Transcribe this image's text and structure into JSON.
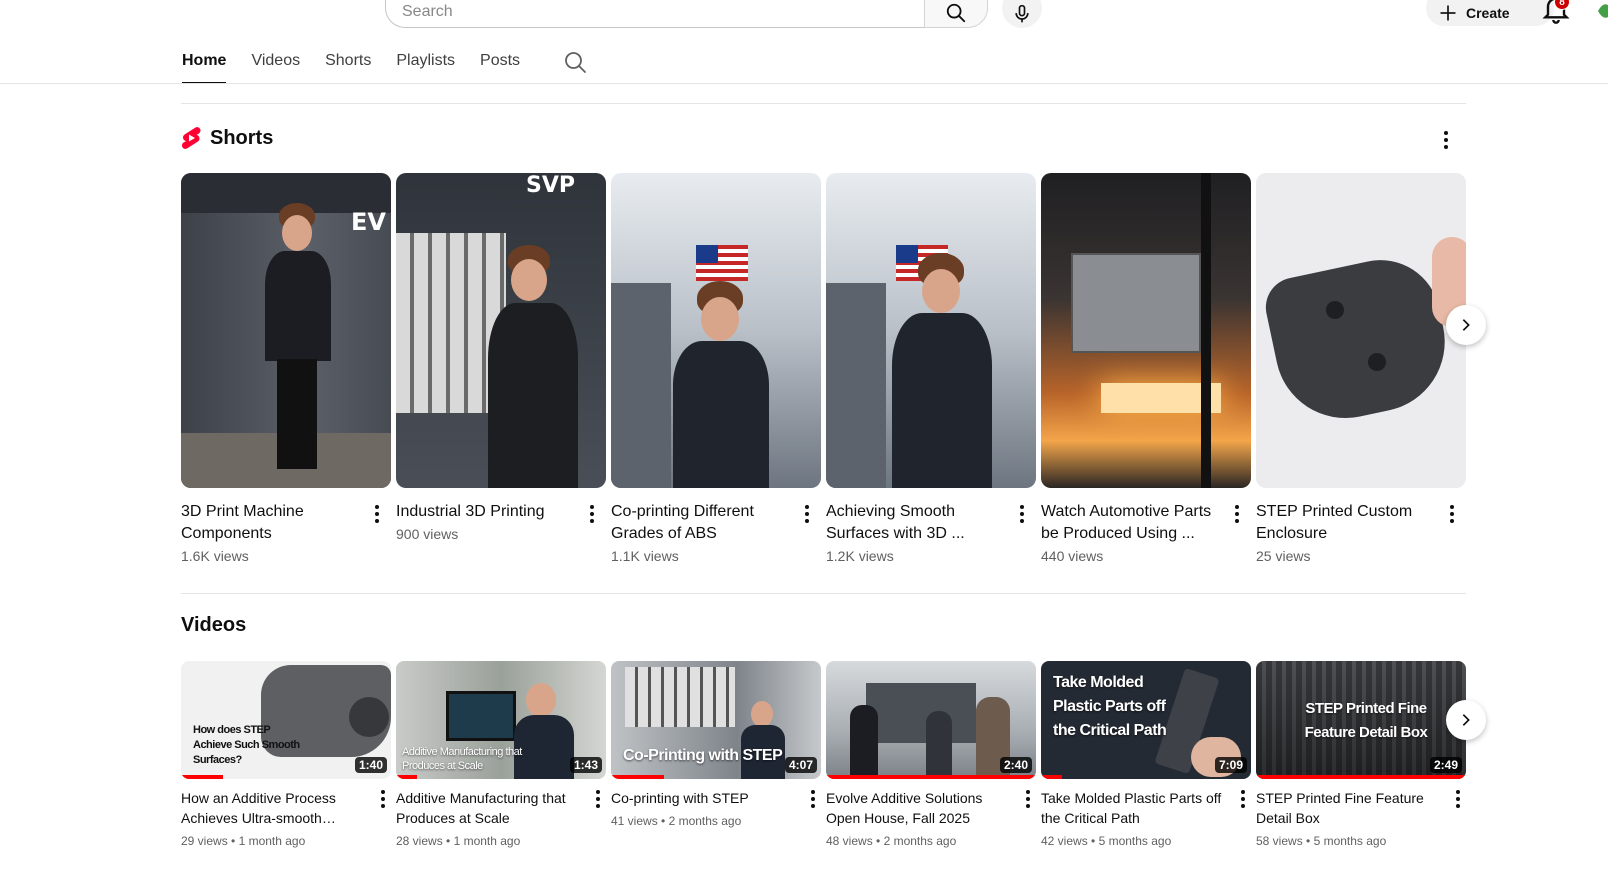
{
  "masthead": {
    "search_placeholder": "Search",
    "create_label": "Create",
    "notification_count": "8"
  },
  "tabs": [
    {
      "label": "Home",
      "active": true
    },
    {
      "label": "Videos",
      "active": false
    },
    {
      "label": "Shorts",
      "active": false
    },
    {
      "label": "Playlists",
      "active": false
    },
    {
      "label": "Posts",
      "active": false
    }
  ],
  "shorts_section": {
    "title": "Shorts",
    "items": [
      {
        "title": "3D Print Machine Components",
        "views": "1.6K views"
      },
      {
        "title": "Industrial 3D Printing",
        "views": "900 views"
      },
      {
        "title": "Co-printing Different Grades of ABS",
        "views": "1.1K views"
      },
      {
        "title": "Achieving Smooth Surfaces with 3D ...",
        "views": "1.2K views"
      },
      {
        "title": "Watch Automotive Parts be Produced Using ...",
        "views": "440 views"
      },
      {
        "title": "STEP Printed Custom Enclosure",
        "views": "25 views"
      }
    ]
  },
  "videos_section": {
    "title": "Videos",
    "items": [
      {
        "title": "How an Additive Process Achieves Ultra-smooth…",
        "views": "29 views",
        "age": "1 month ago",
        "duration": "1:40",
        "thumb_text": "How does STEP Achieve Such Smooth Surfaces?",
        "watched": 0.2
      },
      {
        "title": "Additive Manufacturing that Produces at Scale",
        "views": "28 views",
        "age": "1 month ago",
        "duration": "1:43",
        "thumb_text": "Additive Manufacturing that Produces at Scale",
        "watched": 0.1
      },
      {
        "title": "Co-printing with STEP",
        "views": "41 views",
        "age": "2 months ago",
        "duration": "4:07",
        "thumb_text": "Co-Printing with STEP",
        "watched": 0.25
      },
      {
        "title": "Evolve Additive Solutions Open House, Fall 2025",
        "views": "48 views",
        "age": "2 months ago",
        "duration": "2:40",
        "thumb_text": "",
        "watched": 1.0
      },
      {
        "title": "Take Molded Plastic Parts off the Critical Path",
        "views": "42 views",
        "age": "5 months ago",
        "duration": "7:09",
        "thumb_text": "Take Molded Plastic Parts off the Critical Path",
        "watched": 0.1
      },
      {
        "title": "STEP Printed Fine Feature Detail Box",
        "views": "58 views",
        "age": "5 months ago",
        "duration": "2:49",
        "thumb_text": "STEP Printed Fine Feature Detail Box",
        "watched": 1.0
      }
    ]
  },
  "colors": {
    "accent_red": "#ff0000",
    "shorts_logo": "#ff0033",
    "badge": "#cc0000"
  }
}
